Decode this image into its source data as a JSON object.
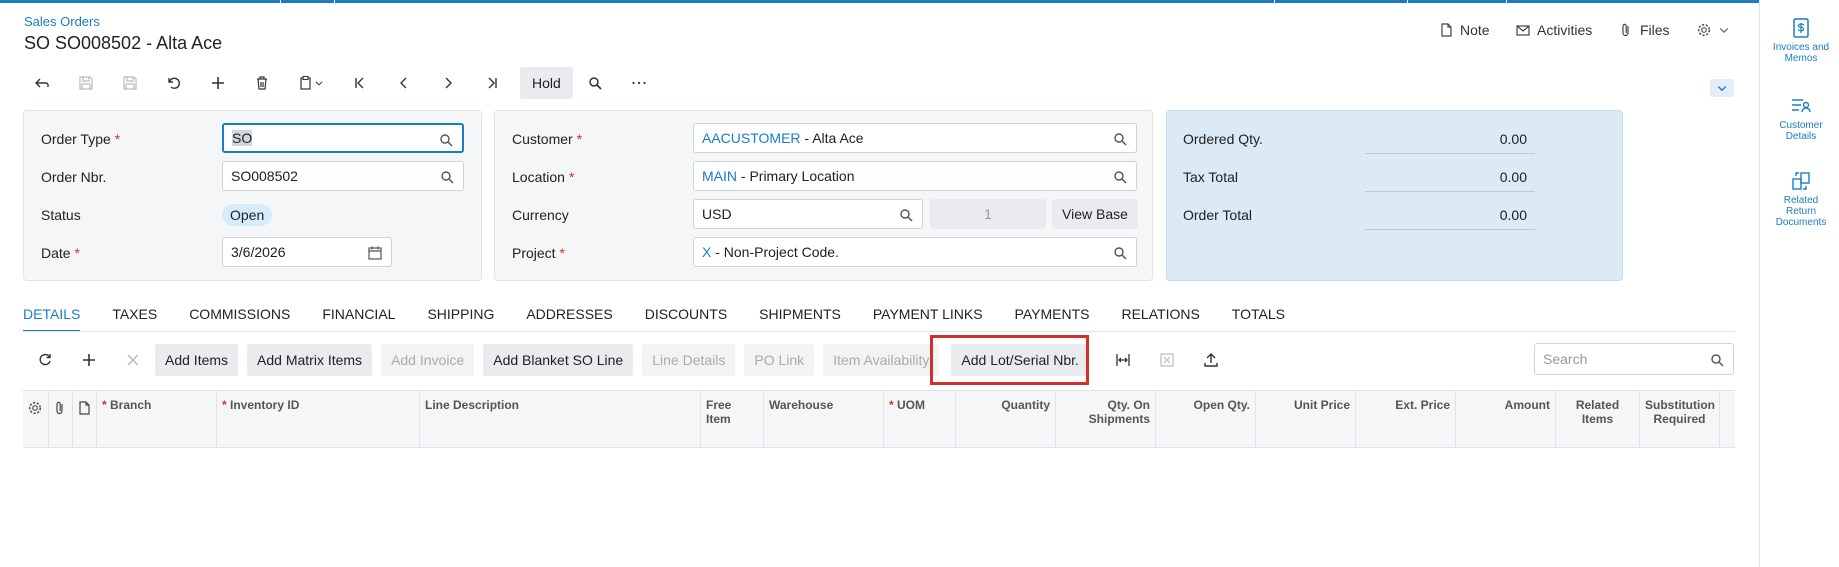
{
  "header": {
    "breadcrumb": "Sales Orders",
    "title": "SO SO008502 - Alta Ace",
    "actions": {
      "note": "Note",
      "activities": "Activities",
      "files": "Files"
    }
  },
  "toolbar": {
    "hold": "Hold"
  },
  "order": {
    "order_type_label": "Order Type",
    "order_type_value": "SO",
    "order_nbr_label": "Order Nbr.",
    "order_nbr_value": "SO008502",
    "status_label": "Status",
    "status_value": "Open",
    "date_label": "Date",
    "date_value": "3/6/2026"
  },
  "customer": {
    "customer_label": "Customer",
    "customer_id": "AACUSTOMER",
    "customer_name": " - Alta Ace",
    "location_label": "Location",
    "location_id": "MAIN",
    "location_name": " - Primary Location",
    "currency_label": "Currency",
    "currency_value": "USD",
    "rate_value": "1",
    "view_base": "View Base",
    "project_label": "Project",
    "project_id": "X",
    "project_name": " - Non-Project Code."
  },
  "summary": {
    "ordered_qty_label": "Ordered Qty.",
    "ordered_qty_value": "0.00",
    "tax_total_label": "Tax Total",
    "tax_total_value": "0.00",
    "order_total_label": "Order Total",
    "order_total_value": "0.00"
  },
  "tabs": [
    "DETAILS",
    "TAXES",
    "COMMISSIONS",
    "FINANCIAL",
    "SHIPPING",
    "ADDRESSES",
    "DISCOUNTS",
    "SHIPMENTS",
    "PAYMENT LINKS",
    "PAYMENTS",
    "RELATIONS",
    "TOTALS"
  ],
  "grid_toolbar": {
    "add_items": "Add Items",
    "add_matrix_items": "Add Matrix Items",
    "add_invoice": "Add Invoice",
    "add_blanket": "Add Blanket SO Line",
    "line_details": "Line Details",
    "po_link": "PO Link",
    "item_availability": "Item Availability",
    "add_lot_serial": "Add Lot/Serial Nbr.",
    "search_placeholder": "Search"
  },
  "columns": {
    "branch": "Branch",
    "inventory_id": "Inventory ID",
    "line_description": "Line Description",
    "free_item": "Free Item",
    "warehouse": "Warehouse",
    "uom": "UOM",
    "quantity": "Quantity",
    "qty_on_shipments_1": "Qty. On",
    "qty_on_shipments_2": "Shipments",
    "open_qty": "Open Qty.",
    "unit_price": "Unit Price",
    "ext_price": "Ext. Price",
    "amount": "Amount",
    "related_items_1": "Related",
    "related_items_2": "Items",
    "substitution_1": "Substitution",
    "substitution_2": "Required"
  },
  "rail": {
    "invoices_1": "Invoices and",
    "invoices_2": "Memos",
    "customer_1": "Customer",
    "customer_2": "Details",
    "related_1": "Related",
    "related_2": "Return",
    "related_3": "Documents"
  },
  "colors": {
    "accent": "#1a7dc4",
    "highlight": "#d32f2f",
    "summary_bg": "#dceaf6"
  }
}
